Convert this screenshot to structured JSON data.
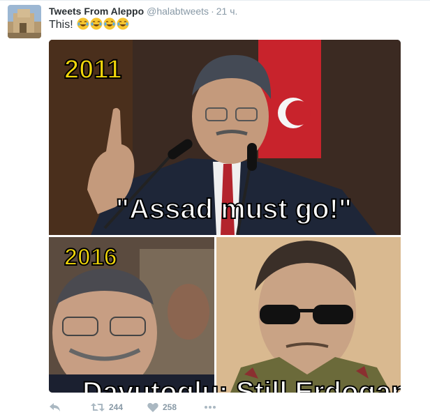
{
  "tweet": {
    "author_name": "Tweets From Aleppo",
    "author_handle": "@halabtweets",
    "separator": "·",
    "timestamp": "21 ч.",
    "text": "This!",
    "emoji": [
      "face-with-tears-of-joy",
      "face-with-tears-of-joy",
      "face-with-tears-of-joy",
      "face-with-tears-of-joy"
    ]
  },
  "media": {
    "caption_year_top": "2011",
    "caption_quote": "\"Assad must go!\"",
    "caption_year_bottom": "2016",
    "caption_bottom_cut": "Davutoglu: Still Erdogan"
  },
  "actions": {
    "reply_icon": "reply-icon",
    "retweet_icon": "retweet-icon",
    "retweet_count": "244",
    "like_icon": "heart-icon",
    "like_count": "258",
    "more_icon": "more-icon"
  },
  "colors": {
    "text": "#292f33",
    "muted": "#8899a6",
    "meme_yellow": "#f2d70a",
    "border": "#e6ecf0"
  }
}
